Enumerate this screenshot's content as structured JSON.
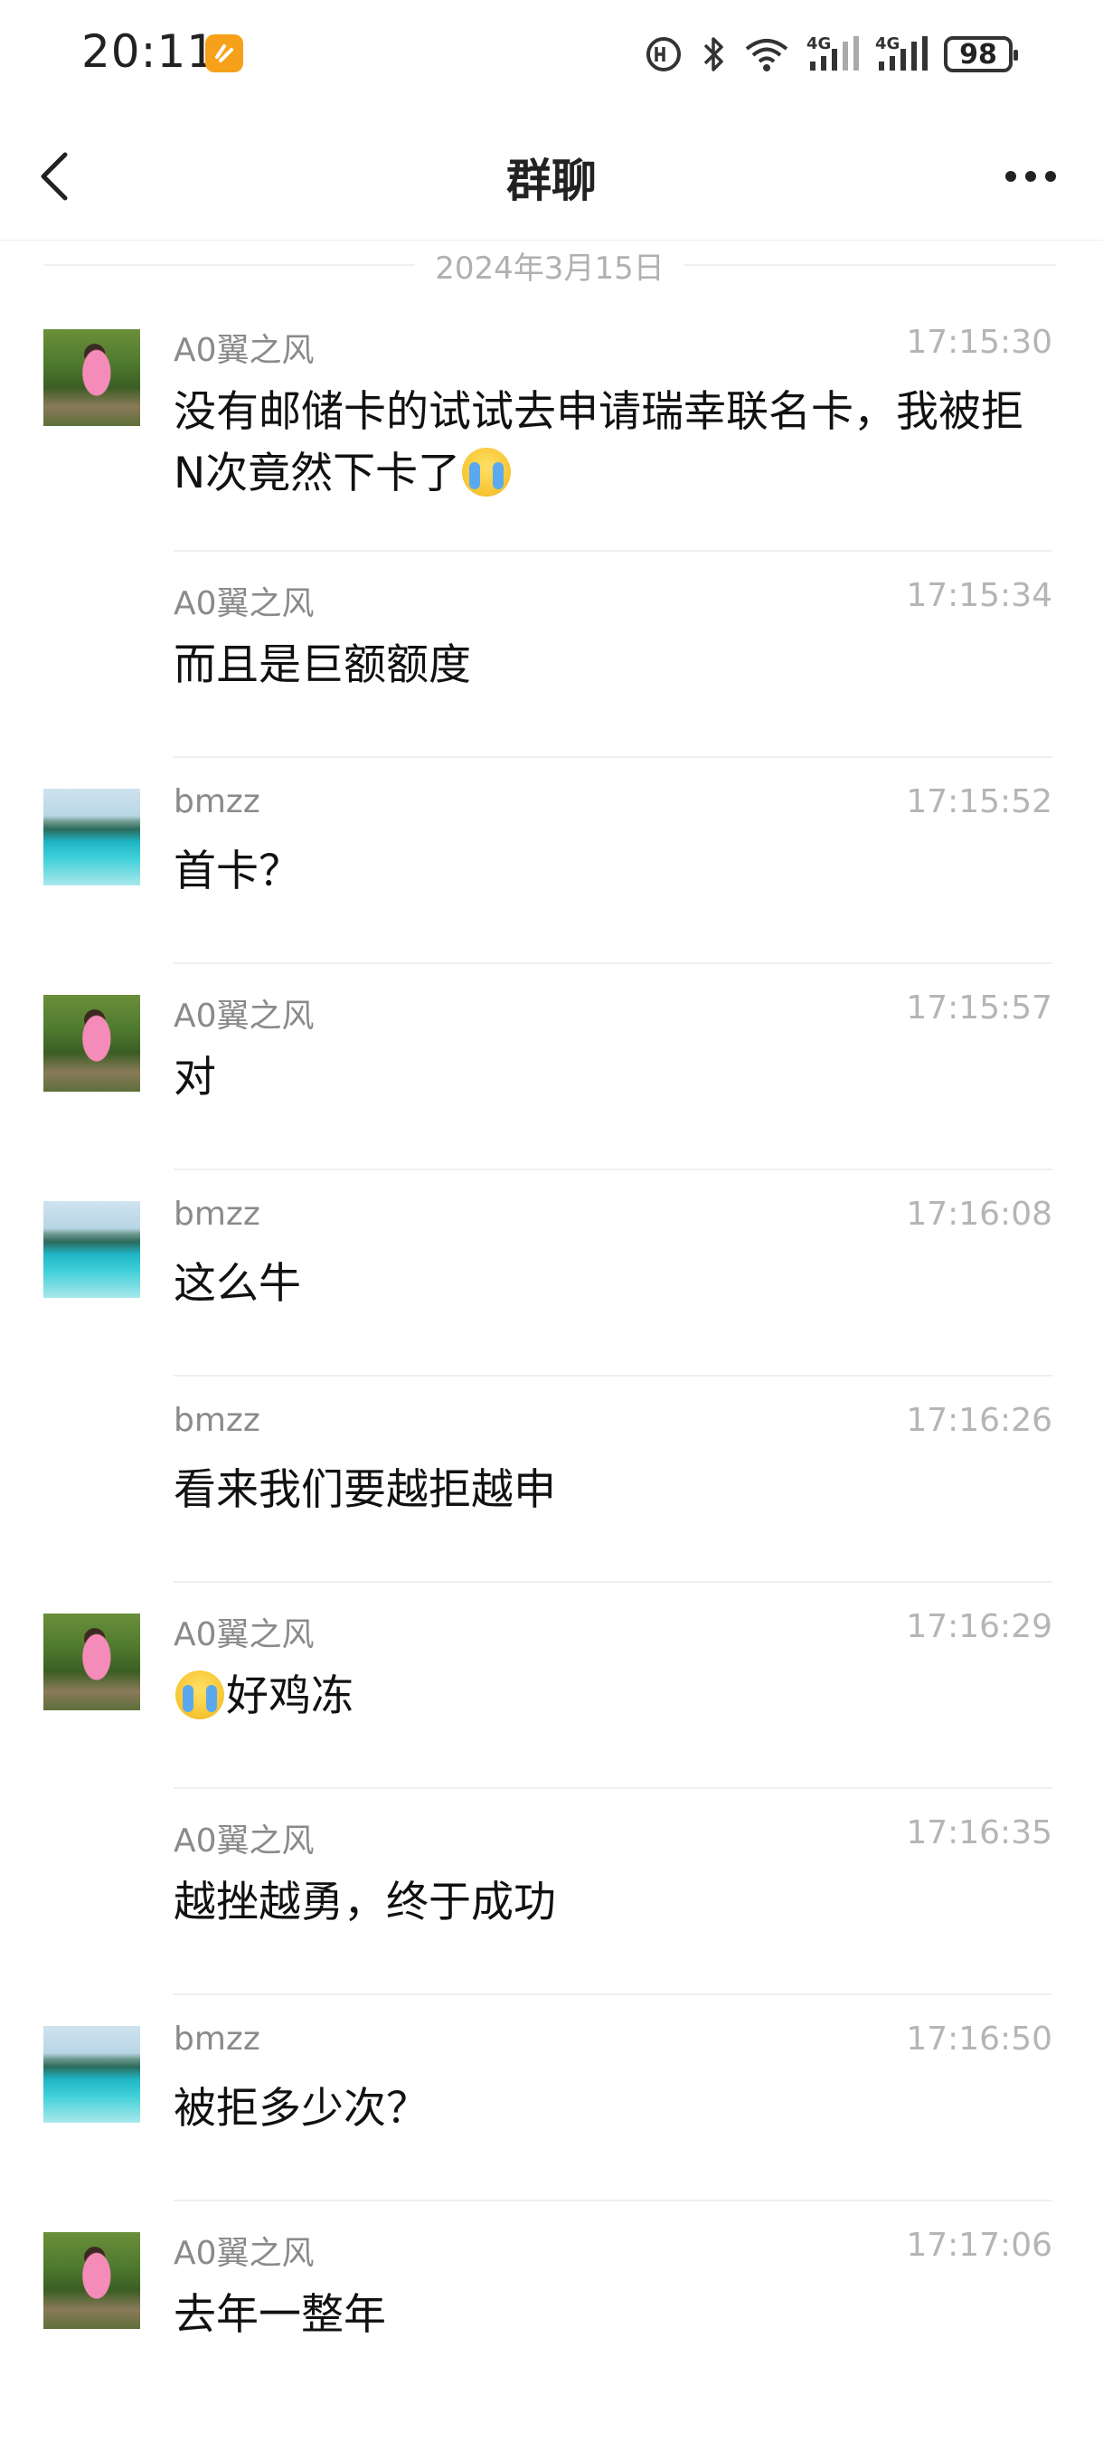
{
  "status_bar": {
    "time": "20:11",
    "battery": "98",
    "network_1": "4G",
    "network_2": "4G",
    "icons": [
      "app-badge-icon",
      "hd-call-icon",
      "bluetooth-icon",
      "wifi-icon",
      "signal-icon",
      "signal-icon",
      "battery-icon"
    ]
  },
  "header": {
    "title": "群聊",
    "back_icon": "chevron-left-icon",
    "more_icon": "more-dots-icon"
  },
  "date_divider": "2024年3月15日",
  "messages": [
    {
      "name": "A0翼之风",
      "time": "17:15:30",
      "avatar": "a0",
      "text": "没有邮储卡的试试去申请瑞幸联名卡，我被拒N次竟然下卡了",
      "emoji_after": "crying-emoji"
    },
    {
      "name": "A0翼之风",
      "time": "17:15:34",
      "avatar": "",
      "text": "而且是巨额额度"
    },
    {
      "name": "bmzz",
      "time": "17:15:52",
      "avatar": "bm",
      "text": "首卡？"
    },
    {
      "name": "A0翼之风",
      "time": "17:15:57",
      "avatar": "a0",
      "text": "对"
    },
    {
      "name": "bmzz",
      "time": "17:16:08",
      "avatar": "bm",
      "text": "这么牛"
    },
    {
      "name": "bmzz",
      "time": "17:16:26",
      "avatar": "",
      "text": "看来我们要越拒越申"
    },
    {
      "name": "A0翼之风",
      "time": "17:16:29",
      "avatar": "a0",
      "text": "好鸡冻",
      "emoji_before": "crying-emoji"
    },
    {
      "name": "A0翼之风",
      "time": "17:16:35",
      "avatar": "",
      "text": "越挫越勇，终于成功"
    },
    {
      "name": "bmzz",
      "time": "17:16:50",
      "avatar": "bm",
      "text": "被拒多少次？"
    },
    {
      "name": "A0翼之风",
      "time": "17:17:06",
      "avatar": "a0",
      "text": "去年一整年"
    }
  ]
}
